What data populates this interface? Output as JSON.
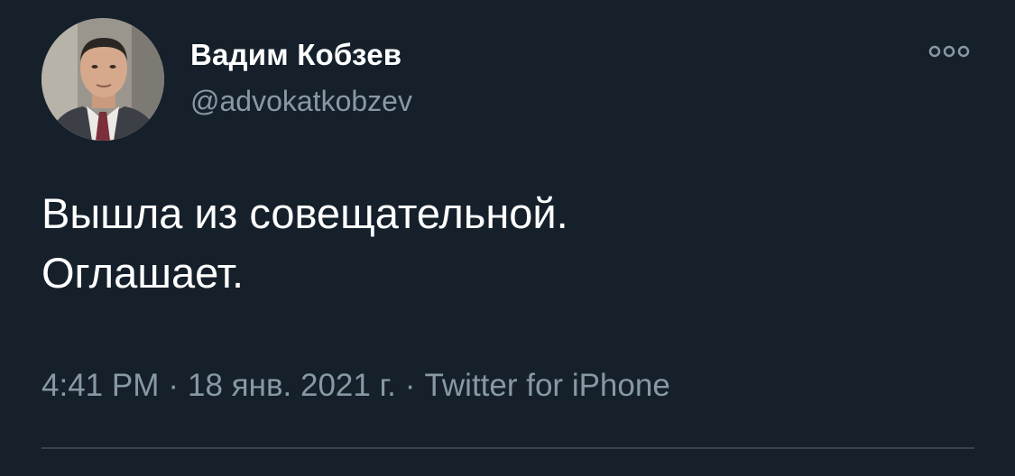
{
  "author": {
    "name": "Вадим Кобзев",
    "handle": "@advokatkobzev",
    "avatar_icon": "profile-photo"
  },
  "more_icon": "more-options-icon",
  "tweet": {
    "lines": [
      "Вышла из совещательной.",
      "Оглашает."
    ]
  },
  "meta": {
    "time": "4:41 PM",
    "date": "18 янв. 2021 г.",
    "separator": "·",
    "source": "Twitter for iPhone"
  },
  "colors": {
    "background": "#15202b",
    "primary_text": "#ffffff",
    "secondary_text": "#8899a6",
    "divider": "#38444d"
  }
}
